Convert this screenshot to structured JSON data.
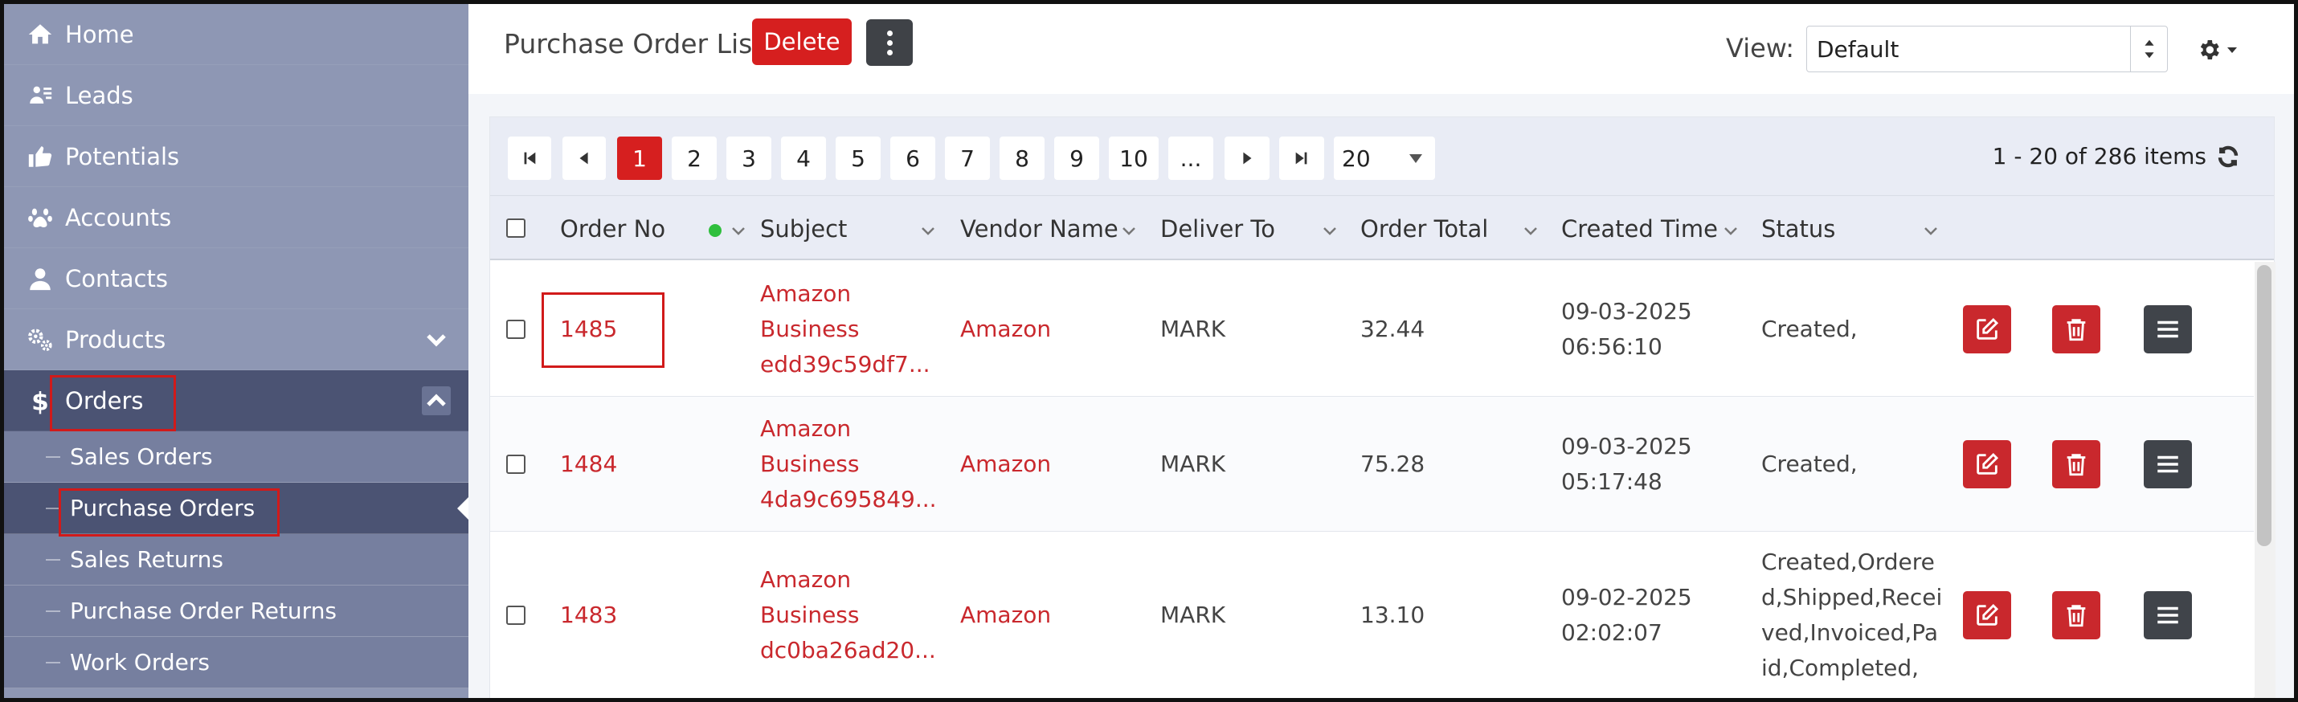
{
  "sidebar": {
    "items": [
      {
        "label": "Home",
        "icon": "home-icon"
      },
      {
        "label": "Leads",
        "icon": "leads-icon"
      },
      {
        "label": "Potentials",
        "icon": "thumbs-up-icon"
      },
      {
        "label": "Accounts",
        "icon": "paw-icon"
      },
      {
        "label": "Contacts",
        "icon": "user-icon"
      },
      {
        "label": "Products",
        "icon": "gears-icon"
      },
      {
        "label": "Orders",
        "icon": "dollar-icon"
      }
    ],
    "orders_submenu": [
      {
        "label": "Sales Orders"
      },
      {
        "label": "Purchase Orders"
      },
      {
        "label": "Sales Returns"
      },
      {
        "label": "Purchase Order Returns"
      },
      {
        "label": "Work Orders"
      }
    ]
  },
  "header": {
    "title": "Purchase Order List",
    "delete_label": "Delete",
    "view_label": "View:",
    "view_value": "Default"
  },
  "pagination": {
    "pages": [
      "1",
      "2",
      "3",
      "4",
      "5",
      "6",
      "7",
      "8",
      "9",
      "10",
      "..."
    ],
    "current": "1",
    "page_size": "20",
    "items_info": "1 - 20 of 286 items"
  },
  "table": {
    "columns": [
      "Order No",
      "Subject",
      "Vendor Name",
      "Deliver To",
      "Order Total",
      "Created Time",
      "Status"
    ],
    "rows": [
      {
        "order_no": "1485",
        "subject": [
          "Amazon",
          "Business",
          "edd39c59df7..."
        ],
        "vendor": "Amazon",
        "deliver_to": "MARK",
        "total": "32.44",
        "created": [
          "09-03-2025",
          "06:56:10"
        ],
        "status": [
          "Created,"
        ]
      },
      {
        "order_no": "1484",
        "subject": [
          "Amazon",
          "Business",
          "4da9c695849..."
        ],
        "vendor": "Amazon",
        "deliver_to": "MARK",
        "total": "75.28",
        "created": [
          "09-03-2025",
          "05:17:48"
        ],
        "status": [
          "Created,"
        ]
      },
      {
        "order_no": "1483",
        "subject": [
          "Amazon",
          "Business",
          "dc0ba26ad20..."
        ],
        "vendor": "Amazon",
        "deliver_to": "MARK",
        "total": "13.10",
        "created": [
          "09-02-2025",
          "02:02:07"
        ],
        "status": [
          "Created,Ordere",
          "d,Shipped,Recei",
          "ved,Invoiced,Pa",
          "id,Completed,"
        ]
      }
    ]
  },
  "colors": {
    "accent": "#d61f1f",
    "sidebar_bg": "#8e97b4",
    "sidebar_active": "#4b5373",
    "link": "#c9282d"
  }
}
